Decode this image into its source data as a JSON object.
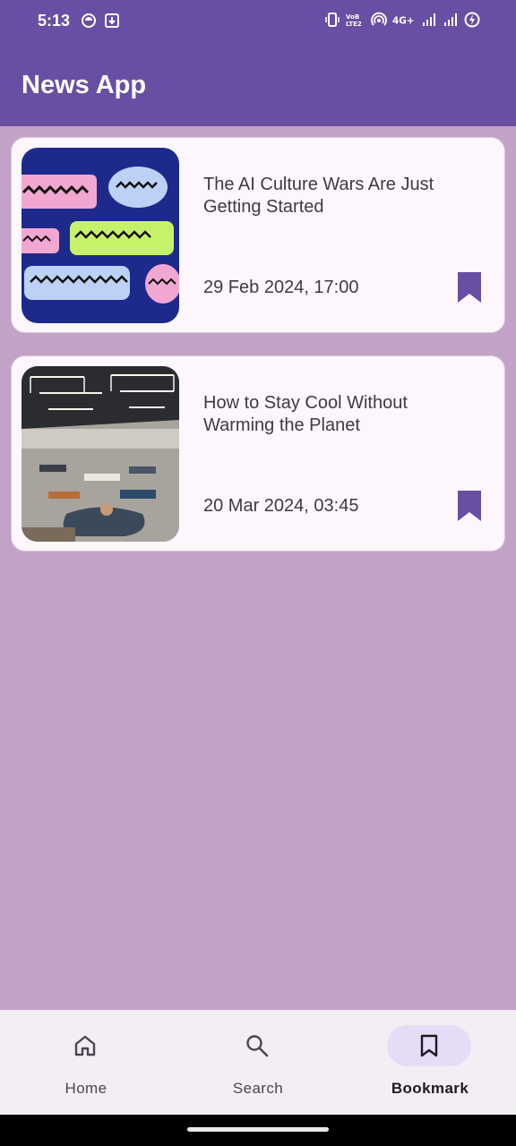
{
  "status_bar": {
    "time": "5:13",
    "left_icons": [
      "sync-icon",
      "download-icon"
    ],
    "right_icons": [
      "vibrate-icon",
      "volte-icon",
      "hotspot-icon",
      "network-4g-icon",
      "signal-1-icon",
      "signal-2-icon",
      "battery-charging-icon"
    ]
  },
  "app_bar": {
    "title": "News App"
  },
  "articles": [
    {
      "title": "The AI Culture Wars Are Just Getting Started",
      "date": "29 Feb 2024, 17:00",
      "bookmarked": true
    },
    {
      "title": "How to Stay Cool Without Warming the Planet",
      "date": "20 Mar 2024, 03:45",
      "bookmarked": true
    }
  ],
  "bottom_nav": {
    "items": [
      {
        "label": "Home",
        "icon": "home-icon",
        "active": false
      },
      {
        "label": "Search",
        "icon": "search-icon",
        "active": false
      },
      {
        "label": "Bookmark",
        "icon": "bookmark-icon",
        "active": true
      }
    ]
  },
  "colors": {
    "primary": "#684fa3",
    "background": "#c3a2c7",
    "card": "#fdf7fd",
    "nav_background": "#f3edf4",
    "nav_active_pill": "#e6dcf5"
  }
}
